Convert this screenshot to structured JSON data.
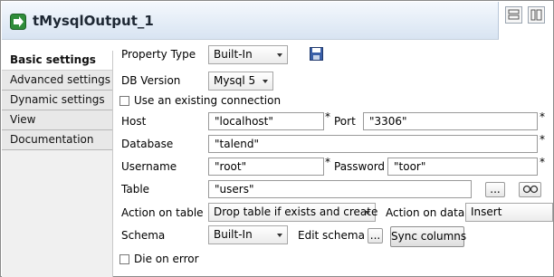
{
  "component": {
    "title": "tMysqlOutput_1",
    "icon": "component-output-icon"
  },
  "sidebar": {
    "tabs": [
      {
        "label": "Basic settings",
        "active": true
      },
      {
        "label": "Advanced settings",
        "active": false
      },
      {
        "label": "Dynamic settings",
        "active": false
      },
      {
        "label": "View",
        "active": false
      },
      {
        "label": "Documentation",
        "active": false
      }
    ]
  },
  "form": {
    "property_type": {
      "label": "Property Type",
      "value": "Built-In"
    },
    "db_version": {
      "label": "DB Version",
      "value": "Mysql 5"
    },
    "use_existing_connection": {
      "label": "Use an existing connection",
      "checked": false
    },
    "host": {
      "label": "Host",
      "value": "\"localhost\""
    },
    "port": {
      "label": "Port",
      "value": "\"3306\""
    },
    "database": {
      "label": "Database",
      "value": "\"talend\""
    },
    "username": {
      "label": "Username",
      "value": "\"root\""
    },
    "password": {
      "label": "Password",
      "value": "\"toor\""
    },
    "table": {
      "label": "Table",
      "value": "\"users\"",
      "browse_label": "..."
    },
    "action_on_table": {
      "label": "Action on table",
      "value": "Drop table if exists and create"
    },
    "action_on_data": {
      "label": "Action on data",
      "value": "Insert"
    },
    "schema": {
      "label": "Schema",
      "value": "Built-In",
      "edit_label": "Edit schema",
      "edit_button": "...",
      "sync_label": "Sync columns"
    },
    "die_on_error": {
      "label": "Die on error",
      "checked": false
    },
    "required_mark": "*"
  }
}
